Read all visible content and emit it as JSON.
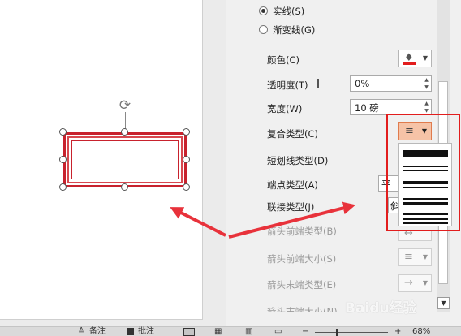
{
  "line_pane": {
    "solid_line_label": "实线(S)",
    "gradient_line_label": "渐变线(G)",
    "color_label": "颜色(C)",
    "transparency_label": "透明度(T)",
    "transparency_value": "0%",
    "width_label": "宽度(W)",
    "width_value": "10 磅",
    "compound_type_label": "复合类型(C)",
    "dash_type_label": "短划线类型(D)",
    "cap_type_label": "端点类型(A)",
    "cap_type_value": "平",
    "join_type_label": "联接类型(J)",
    "join_type_value": "斜",
    "arrow_begin_type_label": "箭头前端类型(B)",
    "arrow_begin_size_label": "箭头前端大小(S)",
    "arrow_end_type_label": "箭头末端类型(E)",
    "arrow_end_size_label": "箭头末端大小(N)"
  },
  "colors": {
    "line_color": "#c8222d",
    "highlight": "#e21d1d",
    "selected_button": "#f6c3a7"
  },
  "compound_menu": {
    "options": [
      "single",
      "double",
      "thick-thin",
      "thin-thick",
      "triple"
    ]
  },
  "statusbar": {
    "notes_label": "备注",
    "comments_label": "批注",
    "zoom": "68%"
  },
  "watermark": "Baidu经验"
}
